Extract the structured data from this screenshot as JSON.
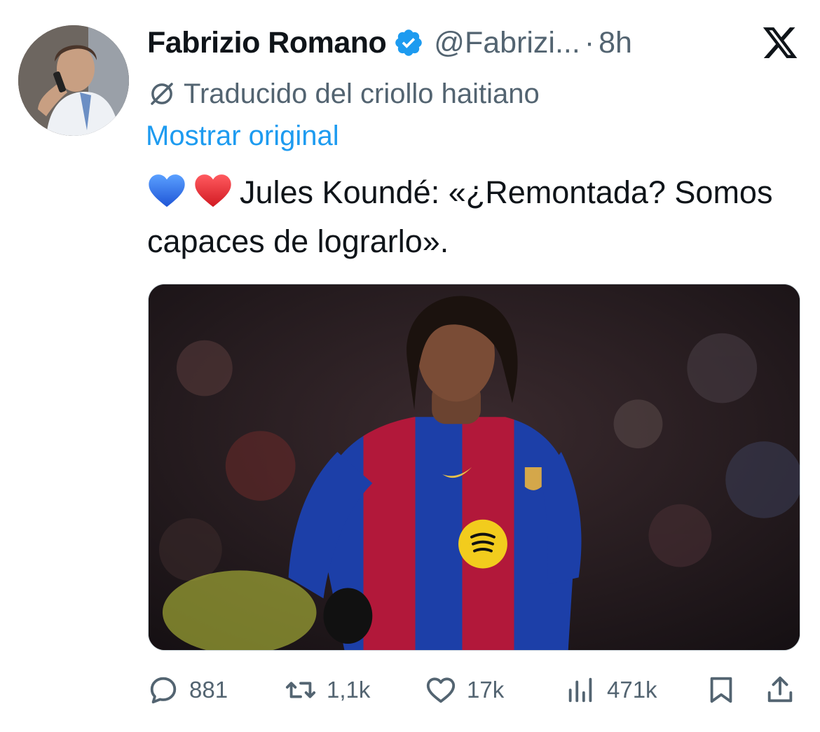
{
  "author": {
    "name": "Fabrizio Romano",
    "handle": "@Fabrizi...",
    "separator": "·",
    "time": "8h",
    "verified": true
  },
  "translation": {
    "notice": "Traducido del criollo haitiano",
    "show_original": "Mostrar original"
  },
  "tweet": {
    "emojis": [
      "blue-heart",
      "red-heart"
    ],
    "text": "Jules Koundé: «¿Remontada? Somos capaces de lograrlo»."
  },
  "media": {
    "description_icon": "photo"
  },
  "metrics": {
    "replies": "881",
    "retweets": "1,1k",
    "likes": "17k",
    "views": "471k"
  },
  "colors": {
    "accent": "#1d9bf0",
    "muted": "#536471",
    "text": "#0f1419",
    "blue_heart": "#2d6fe8",
    "red_heart": "#e0262e"
  }
}
